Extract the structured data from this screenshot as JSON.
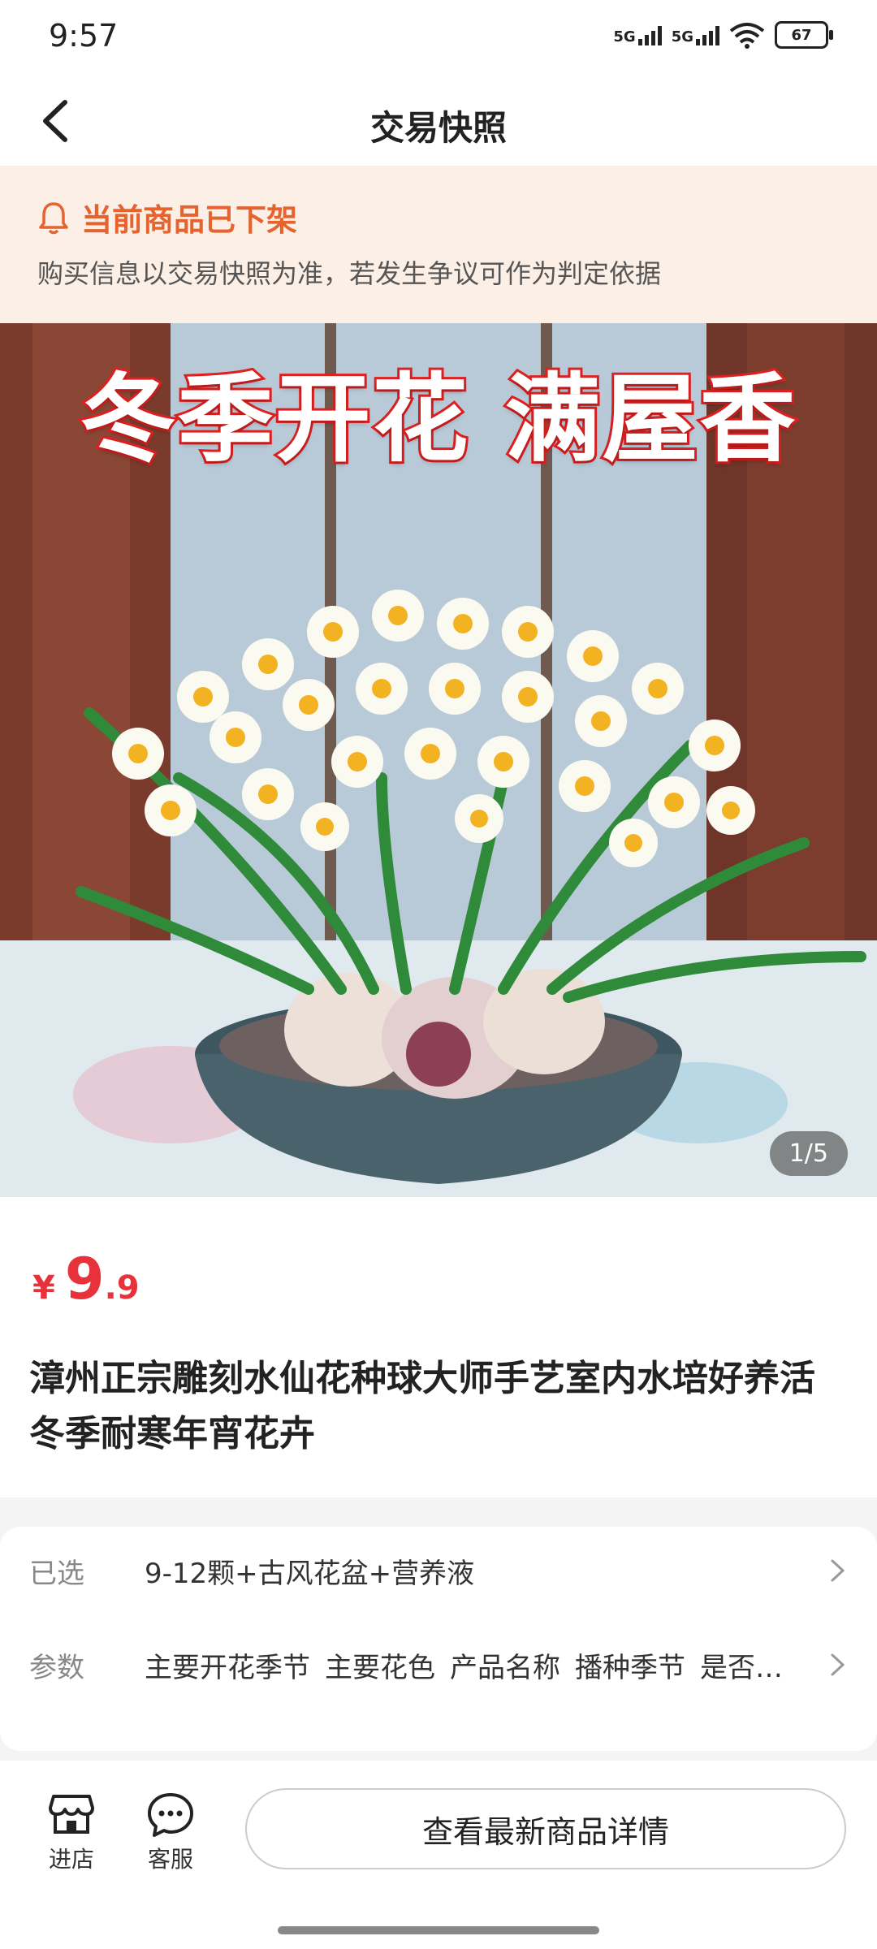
{
  "status_bar": {
    "time": "9:57",
    "signal1": "5G",
    "signal2": "5G",
    "battery": "67"
  },
  "header": {
    "title": "交易快照"
  },
  "notice": {
    "title": "当前商品已下架",
    "description": "购买信息以交易快照为准，若发生争议可作为判定依据"
  },
  "gallery": {
    "promo_text": "冬季开花 满屋香",
    "counter": "1/5"
  },
  "product": {
    "price_symbol": "¥",
    "price_integer": "9",
    "price_decimal": ".9",
    "title": "漳州正宗雕刻水仙花种球大师手艺室内水培好养活冬季耐寒年宵花卉"
  },
  "specs": {
    "selected_label": "已选",
    "selected_value": "9-12颗+古风花盆+营养液",
    "params_label": "参数",
    "params": [
      "主要开花季节",
      "主要花色",
      "产品名称",
      "播种季节",
      "是否…"
    ]
  },
  "bottom_bar": {
    "store_label": "进店",
    "service_label": "客服",
    "view_latest_label": "查看最新商品详情"
  },
  "colors": {
    "accent": "#e4632e",
    "price": "#e7323c",
    "notice_bg": "#fcefe6"
  }
}
